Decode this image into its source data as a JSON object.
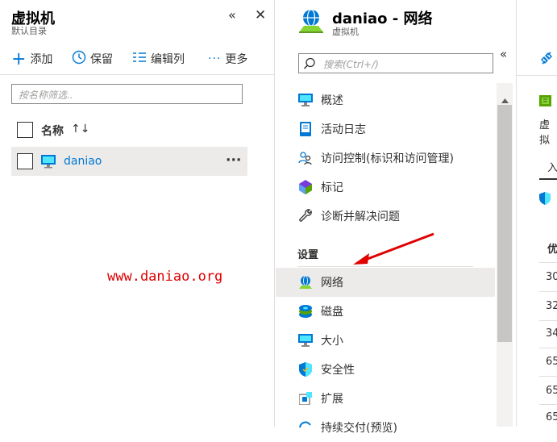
{
  "left_blade": {
    "title": "虚拟机",
    "subtitle": "默认目录",
    "collapse_glyph": "«",
    "close_glyph": "✕",
    "commands": {
      "add": "添加",
      "keep": "保留",
      "edit_columns": "编辑列",
      "more": "更多"
    },
    "filter_placeholder": "按名称筛选..",
    "column_header": "名称",
    "sort_glyph": "↑↓",
    "rows": [
      {
        "name": "daniao",
        "more": "···"
      }
    ],
    "watermark": "www.daniao.org"
  },
  "resource": {
    "title": "daniao - 网络",
    "subtitle": "虚拟机",
    "collapse_glyph": "«",
    "search_placeholder": "搜索(Ctrl+/)",
    "menu": [
      {
        "label": "概述",
        "icon": "monitor-icon"
      },
      {
        "label": "活动日志",
        "icon": "log-icon"
      },
      {
        "label": "访问控制(标识和访问管理)",
        "icon": "people-icon"
      },
      {
        "label": "标记",
        "icon": "tag-icon"
      },
      {
        "label": "诊断并解决问题",
        "icon": "wrench-icon"
      }
    ],
    "section_settings": "设置",
    "settings_menu": [
      {
        "label": "网络",
        "icon": "network-icon",
        "selected": true
      },
      {
        "label": "磁盘",
        "icon": "disk-icon"
      },
      {
        "label": "大小",
        "icon": "monitor-icon"
      },
      {
        "label": "安全性",
        "icon": "shield-icon"
      },
      {
        "label": "扩展",
        "icon": "extension-icon"
      },
      {
        "label": "持续交付(预览)",
        "icon": "delivery-icon"
      }
    ]
  },
  "right_panel": {
    "cut_title": "",
    "cut_label": "虚拟",
    "tab_partial": "入",
    "table_header": "优",
    "values": [
      "30",
      "32",
      "34",
      "65",
      "65",
      "65"
    ]
  },
  "colors": {
    "accent": "#0078d4",
    "selected_bg": "#edebe9",
    "annotation_red": "#e00000"
  }
}
